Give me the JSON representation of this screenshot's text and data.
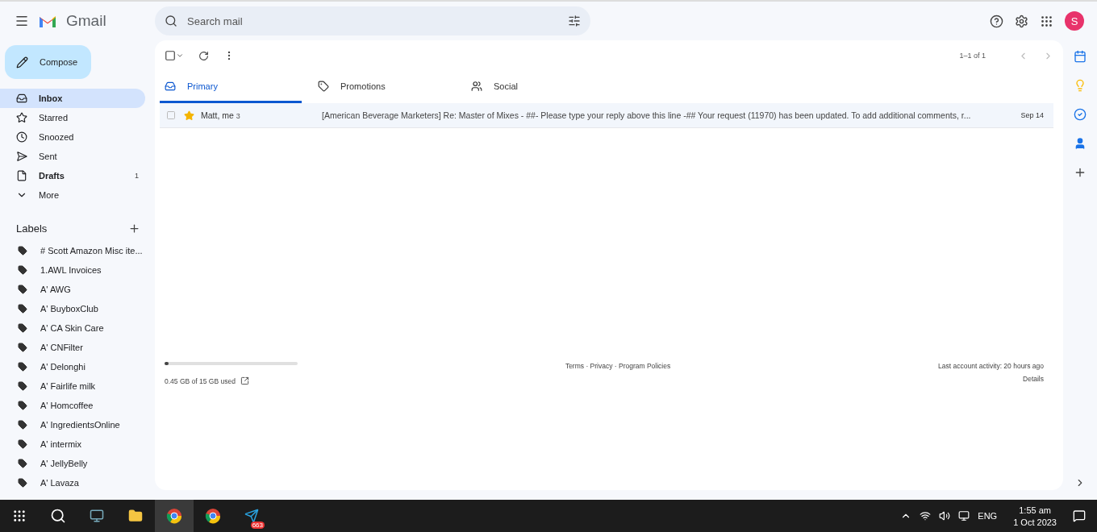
{
  "header": {
    "app_name": "Gmail",
    "search": {
      "placeholder": "Search mail"
    },
    "avatar": "S"
  },
  "compose": "Compose",
  "nav": [
    {
      "kind": "inbox",
      "label": "Inbox",
      "selected": true,
      "unread": true
    },
    {
      "kind": "starred",
      "label": "Starred",
      "selected": false,
      "unread": false
    },
    {
      "kind": "snoozed",
      "label": "Snoozed",
      "selected": false,
      "unread": false
    },
    {
      "kind": "sent",
      "label": "Sent",
      "selected": false,
      "unread": false
    },
    {
      "kind": "drafts",
      "label": "Drafts",
      "count": "1",
      "selected": false,
      "unread": true
    },
    {
      "kind": "more",
      "label": "More",
      "selected": false,
      "unread": false
    }
  ],
  "labels": {
    "title": "Labels",
    "items": [
      "# Scott Amazon Misc ite...",
      "1.AWL Invoices",
      "A' AWG",
      "A' BuyboxClub",
      "A' CA Skin Care",
      "A' CNFilter",
      "A' Delonghi",
      "A' Fairlife milk",
      "A' Homcoffee",
      "A' IngredientsOnline",
      "A' intermix",
      "A' JellyBelly",
      "A' Lavaza"
    ]
  },
  "toolbar": {
    "select_all_checked": false,
    "pagination": "1–1 of 1"
  },
  "tabs": [
    {
      "kind": "primary",
      "label": "Primary",
      "selected": true
    },
    {
      "kind": "promotions",
      "label": "Promotions",
      "selected": false
    },
    {
      "kind": "social",
      "label": "Social",
      "selected": false
    }
  ],
  "emails": [
    {
      "sender": "Matt, me",
      "count": "3",
      "starred": true,
      "checked": false,
      "subject": "[American Beverage Marketers] Re: Master of Mixes - ##- Please type your reply above this line -## Your request (11970) has been updated. To add additional comments, r...",
      "date": "Sep 14"
    }
  ],
  "footer": {
    "storage": {
      "level": 0.03,
      "text": "0.45 GB of 15 GB used"
    },
    "links": "Terms · Privacy · Program Policies",
    "activity": "Last account activity: 20 hours ago",
    "details": "Details"
  },
  "taskbar": {
    "telegram_badge": "663",
    "language": "ENG",
    "time": "1:55 am",
    "date": "1 Oct 2023"
  }
}
